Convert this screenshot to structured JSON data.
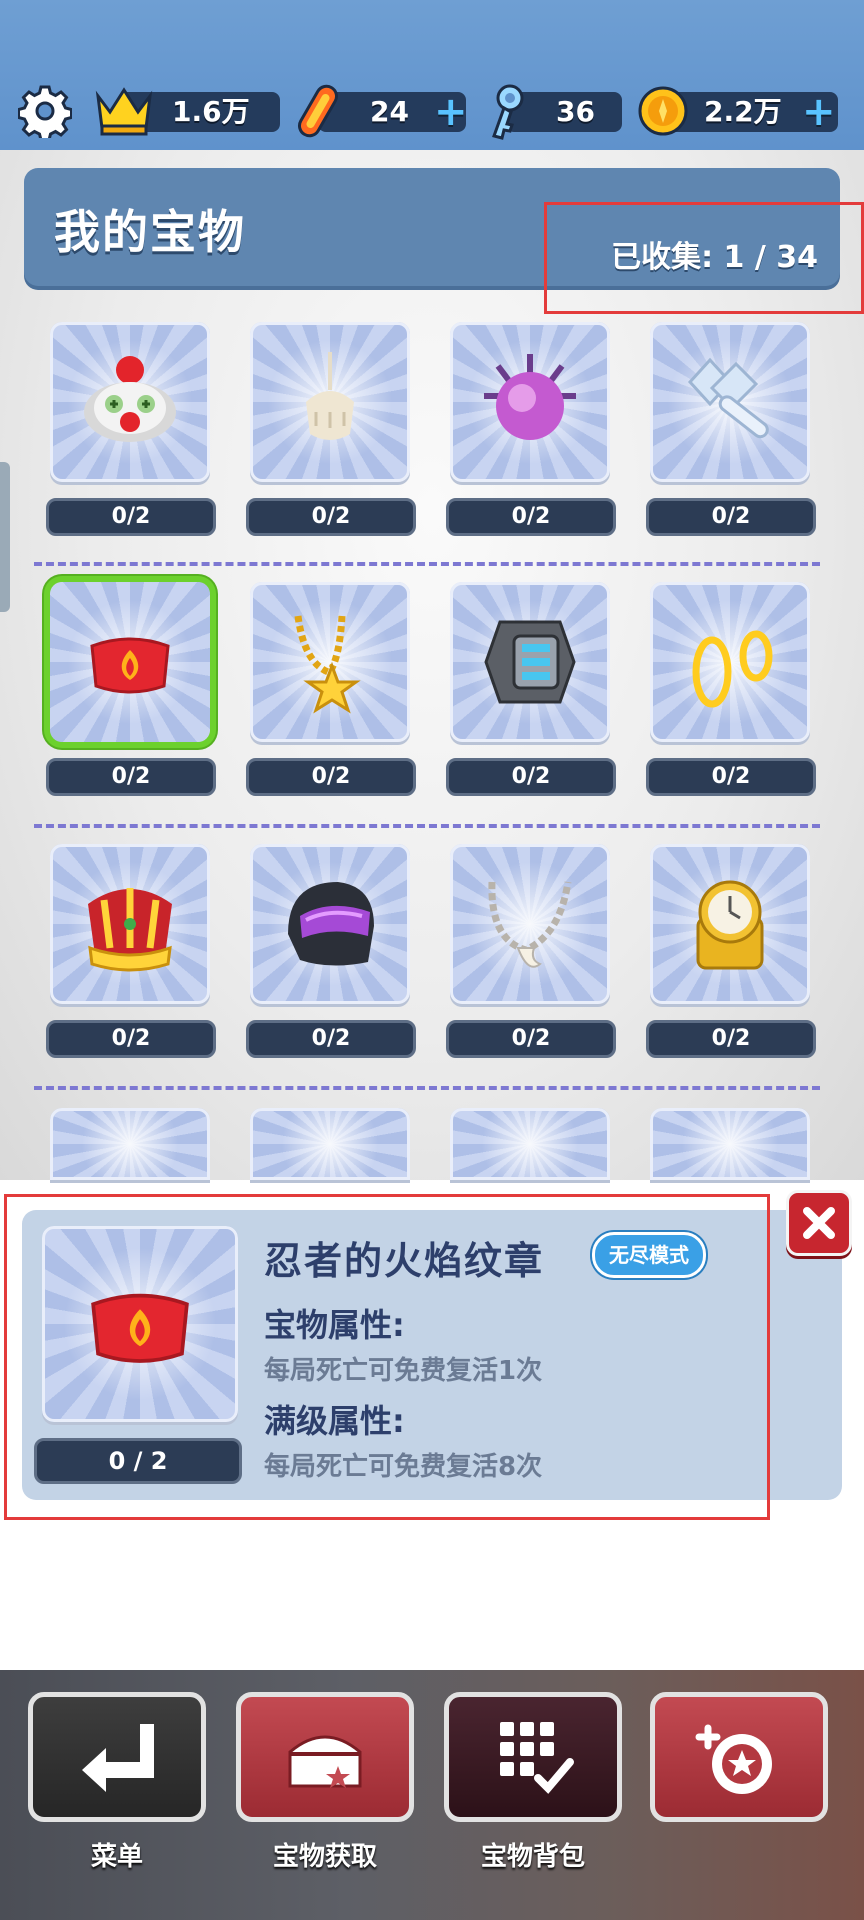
{
  "topbar": {
    "crowns": "1.6万",
    "boards": "24",
    "keys": "36",
    "coins": "2.2万",
    "plus": "+"
  },
  "header": {
    "title": "我的宝物",
    "collected": "已收集: 1 / 34"
  },
  "treasures": [
    {
      "icon": "clown-mask-icon",
      "count": "0/2"
    },
    {
      "icon": "stick-figure-icon",
      "count": "0/2"
    },
    {
      "icon": "purple-ball-icon",
      "count": "0/2"
    },
    {
      "icon": "wind-up-key-icon",
      "count": "0/2"
    },
    {
      "icon": "fire-badge-icon",
      "count": "0/2",
      "selected": true
    },
    {
      "icon": "star-necklace-icon",
      "count": "0/2"
    },
    {
      "icon": "digital-watch-icon",
      "count": "0/2"
    },
    {
      "icon": "gold-rings-icon",
      "count": "0/2"
    },
    {
      "icon": "crown-icon",
      "count": "0/2"
    },
    {
      "icon": "helmet-icon",
      "count": "0/2"
    },
    {
      "icon": "tooth-necklace-icon",
      "count": "0/2"
    },
    {
      "icon": "gold-watch-icon",
      "count": "0/2"
    }
  ],
  "detail": {
    "name": "忍者的火焰纹章",
    "badge": "无尽模式",
    "prop_label": "宝物属性:",
    "prop_text": "每局死亡可免费复活1次",
    "max_label": "满级属性:",
    "max_text": "每局死亡可免费复活8次",
    "count": "0 / 2"
  },
  "nav": [
    {
      "label": "菜单",
      "icon": "return-arrow-icon"
    },
    {
      "label": "宝物获取",
      "icon": "treasure-chest-icon"
    },
    {
      "label": "宝物背包",
      "icon": "grid-check-icon"
    },
    {
      "label": "",
      "icon": "upgrade-badge-icon"
    }
  ],
  "colors": {
    "header_blue": "#5f86b0",
    "highlight_red": "#e33b3b",
    "selected_green": "#6cd12d",
    "nav_red": "#b83a43",
    "nav_dark": "#3a1b22"
  }
}
